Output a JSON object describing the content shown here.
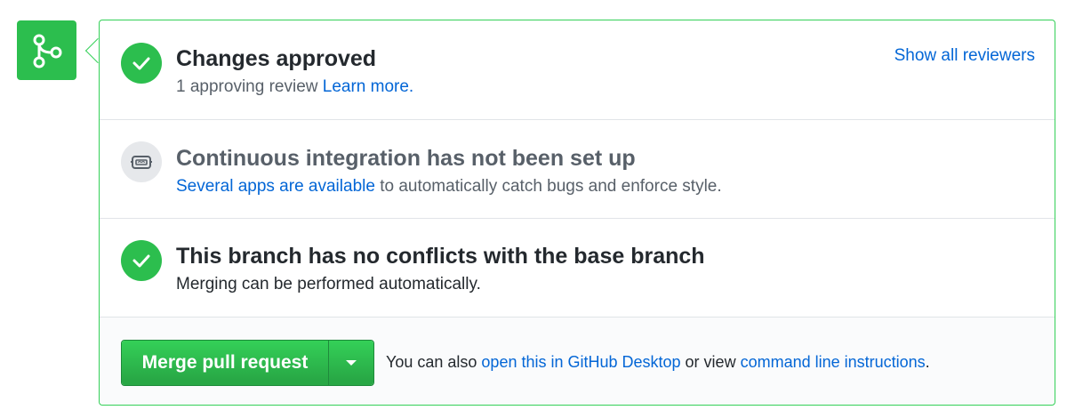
{
  "approved": {
    "title": "Changes approved",
    "desc_prefix": "1 approving review",
    "learn_more": "Learn more.",
    "show_all_reviewers": "Show all reviewers"
  },
  "ci": {
    "title": "Continuous integration has not been set up",
    "apps_link": "Several apps are available",
    "desc_suffix": " to automatically catch bugs and enforce style."
  },
  "conflicts": {
    "title": "This branch has no conflicts with the base branch",
    "desc": "Merging can be performed automatically."
  },
  "merge": {
    "button_label": "Merge pull request",
    "text_prefix": "You can also ",
    "desktop_link": "open this in GitHub Desktop",
    "text_middle": " or view ",
    "cli_link": "command line instructions",
    "text_suffix": "."
  },
  "colors": {
    "success_green": "#2cbe4e",
    "border_green": "#34d058",
    "link_blue": "#0366d6",
    "muted_text": "#586069"
  },
  "icons": {
    "merge": "git-merge-icon",
    "check": "check-icon",
    "ci": "ci-robot-icon",
    "caret": "triangle-down-icon"
  }
}
